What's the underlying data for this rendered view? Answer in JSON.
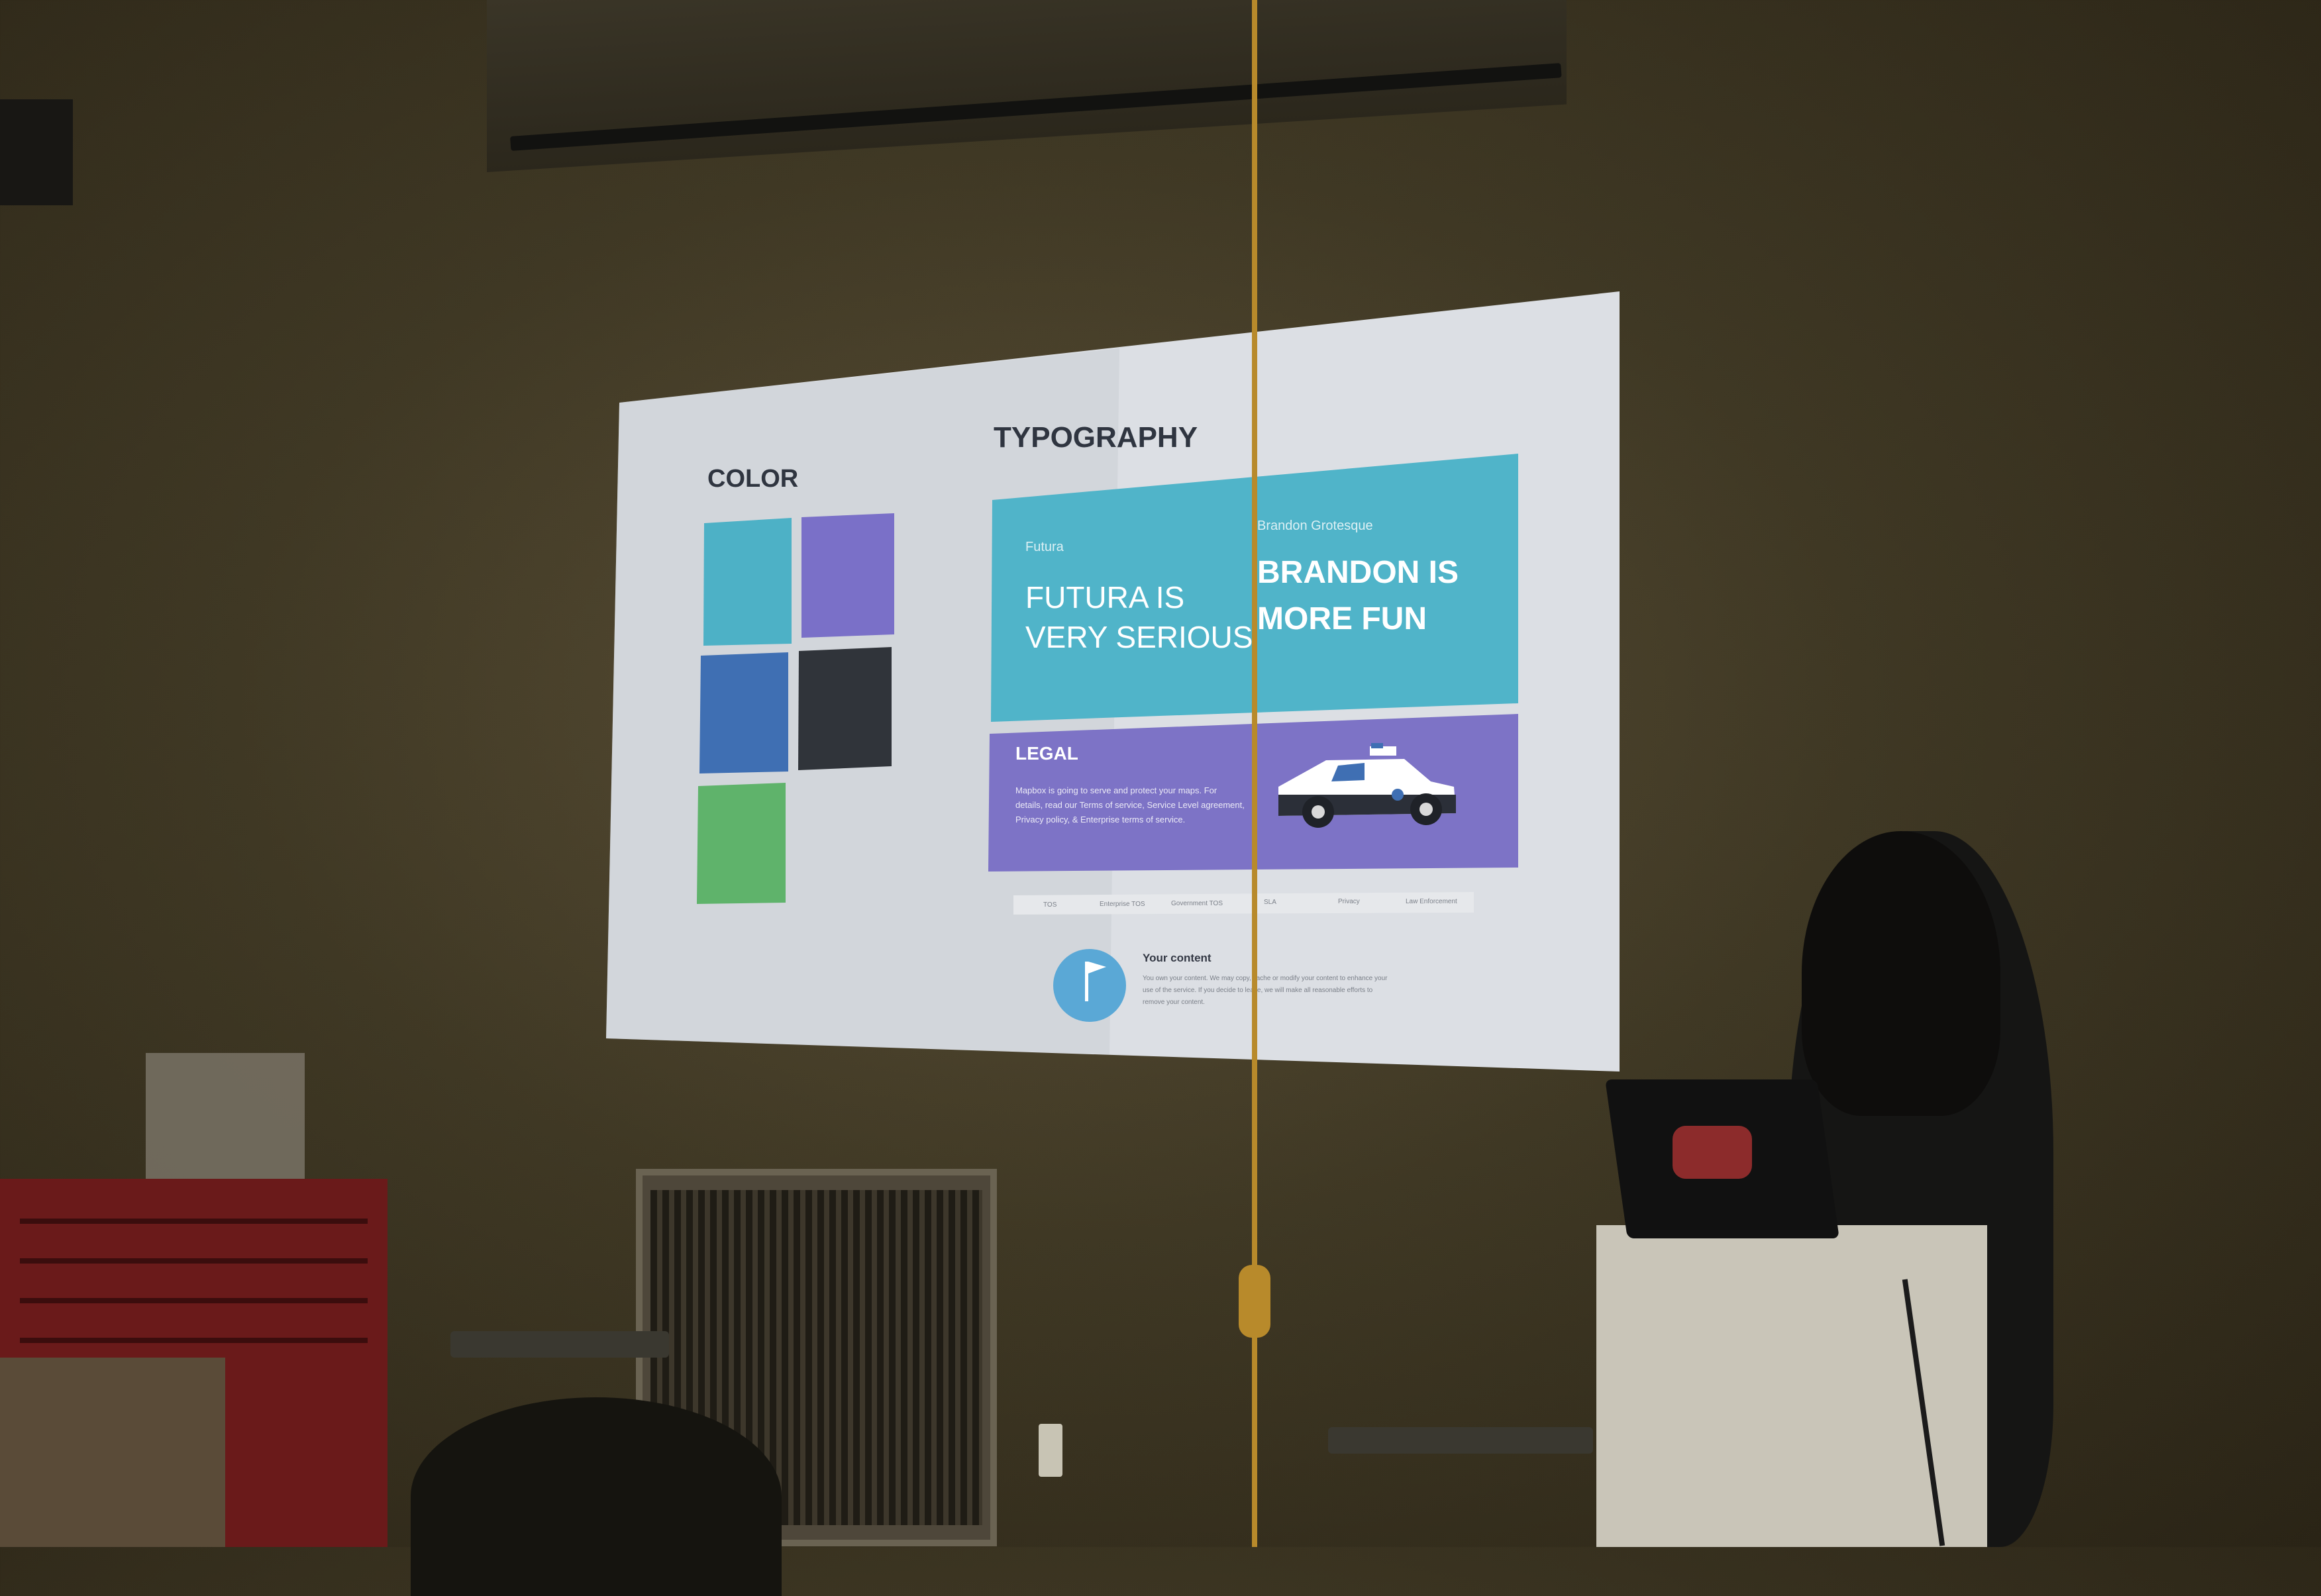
{
  "slide": {
    "color_heading": "COLOR",
    "typography_heading": "TYPOGRAPHY",
    "swatches": [
      {
        "name": "teal",
        "hex": "#4db1c6"
      },
      {
        "name": "purple",
        "hex": "#7a70c8"
      },
      {
        "name": "blue",
        "hex": "#3f6fb3"
      },
      {
        "name": "dark",
        "hex": "#30343a"
      },
      {
        "name": "green",
        "hex": "#5fb36b"
      }
    ],
    "typeface_card": {
      "bg": "#50b4c9",
      "left_small": "Futura",
      "left_big_line1": "FUTURA IS",
      "left_big_line2": "VERY SERIOUS",
      "right_small": "Brandon Grotesque",
      "right_big_line1": "BRANDON IS",
      "right_big_line2": "MORE FUN"
    },
    "legal_card": {
      "bg": "#7d73c6",
      "title": "LEGAL",
      "body_line1": "Mapbox is going to serve and protect your maps. For",
      "body_line2": "details, read our Terms of service, Service Level agreement,",
      "body_line3": "Privacy policy, & Enterprise terms of service."
    },
    "tabs": [
      "TOS",
      "Enterprise TOS",
      "Government TOS",
      "SLA",
      "Privacy",
      "Law Enforcement"
    ],
    "content_section": {
      "title": "Your content",
      "body_line1": "You own your content. We may copy, cache or modify your content to enhance your",
      "body_line2": "use of the service. If you decide to leave, we will make all reasonable efforts to",
      "body_line3": "remove your content."
    }
  }
}
